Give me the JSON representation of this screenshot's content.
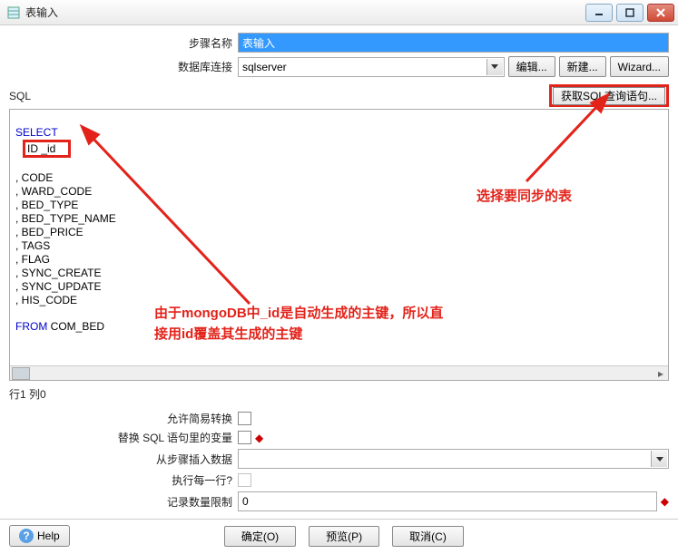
{
  "window": {
    "title": "表输入"
  },
  "form": {
    "step_name_label": "步骤名称",
    "step_name_value": "表输入",
    "db_conn_label": "数据库连接",
    "db_conn_value": "sqlserver",
    "btn_edit": "编辑...",
    "btn_new": "新建...",
    "btn_wizard": "Wizard..."
  },
  "sql": {
    "label": "SQL",
    "get_sql_btn": "获取SQL查询语句...",
    "keyword_select": "SELECT",
    "id_line": "ID _id",
    "lines": [
      ", CODE",
      ", WARD_CODE",
      ", BED_TYPE",
      ", BED_TYPE_NAME",
      ", BED_PRICE",
      ", TAGS",
      ", FLAG",
      ", SYNC_CREATE",
      ", SYNC_UPDATE",
      ", HIS_CODE"
    ],
    "keyword_from": "FROM",
    "from_rest": " COM_BED"
  },
  "status": {
    "rowcol": "行1 列0"
  },
  "lower": {
    "allow_lazy_label": "允许简易转换",
    "replace_vars_label": "替换 SQL 语句里的变量",
    "insert_from_step_label": "从步骤插入数据",
    "exec_each_row_label": "执行每一行?",
    "record_limit_label": "记录数量限制",
    "record_limit_value": "0"
  },
  "buttons": {
    "help": "Help",
    "ok": "确定(O)",
    "preview": "预览(P)",
    "cancel": "取消(C)"
  },
  "annotations": {
    "a1": "由于mongoDB中_id是自动生成的主键，所以直接用id覆盖其生成的主键",
    "a2": "选择要同步的表"
  }
}
